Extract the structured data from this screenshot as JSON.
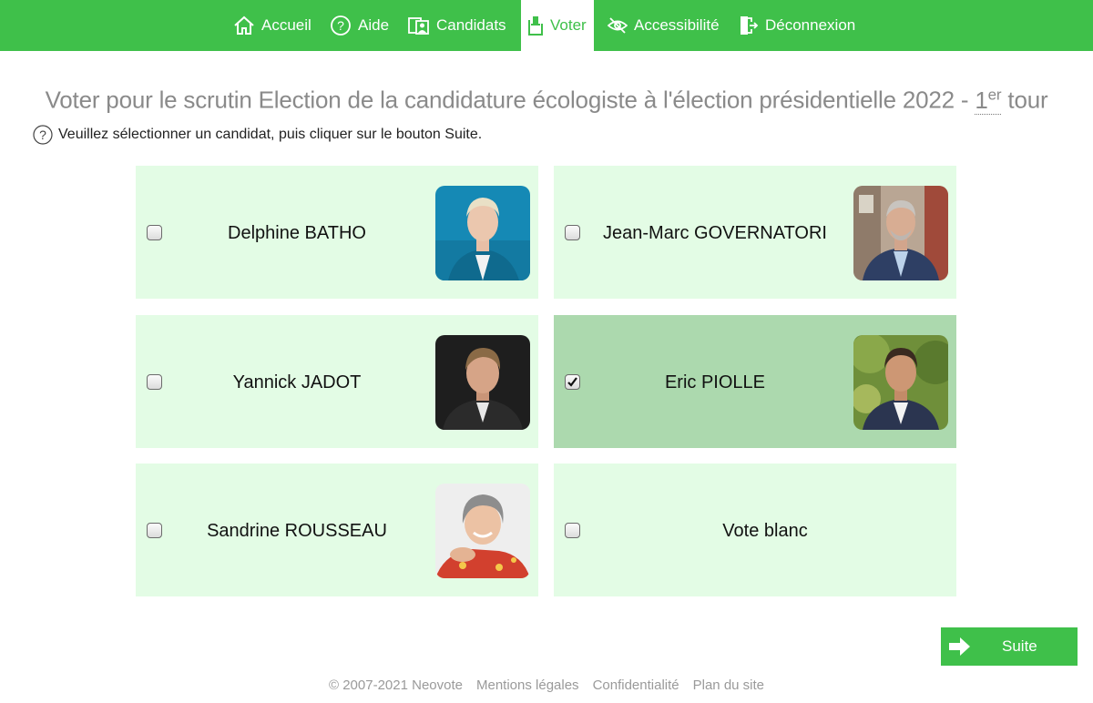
{
  "nav": {
    "items": [
      {
        "label": "Accueil",
        "icon": "home-icon"
      },
      {
        "label": "Aide",
        "icon": "help-icon"
      },
      {
        "label": "Candidats",
        "icon": "candidates-icon"
      },
      {
        "label": "Voter",
        "icon": "vote-icon",
        "active": true
      },
      {
        "label": "Accessibilité",
        "icon": "eye-slash-icon"
      },
      {
        "label": "Déconnexion",
        "icon": "logout-icon"
      }
    ]
  },
  "page": {
    "title_prefix": "Voter pour le scrutin Election de la candidature écologiste à l'élection présidentielle 2022 - ",
    "round_number": "1",
    "round_suffix": "er",
    "round_word": " tour",
    "instruction": "Veuillez sélectionner un candidat, puis cliquer sur le bouton Suite."
  },
  "candidates": [
    {
      "name": "Delphine BATHO",
      "checked": false
    },
    {
      "name": "Jean-Marc GOVERNATORI",
      "checked": false
    },
    {
      "name": "Yannick JADOT",
      "checked": false
    },
    {
      "name": "Eric PIOLLE",
      "checked": true
    },
    {
      "name": "Sandrine ROUSSEAU",
      "checked": false
    },
    {
      "name": "Vote blanc",
      "checked": false
    }
  ],
  "suite_button": {
    "label": "Suite"
  },
  "footer": {
    "copyright": "© 2007-2021 Neovote",
    "links": [
      "Mentions légales",
      "Confidentialité",
      "Plan du site"
    ]
  },
  "colors": {
    "accent": "#3fc04a",
    "card_bg": "#e3fce5",
    "card_selected_bg": "#acd9ae"
  }
}
